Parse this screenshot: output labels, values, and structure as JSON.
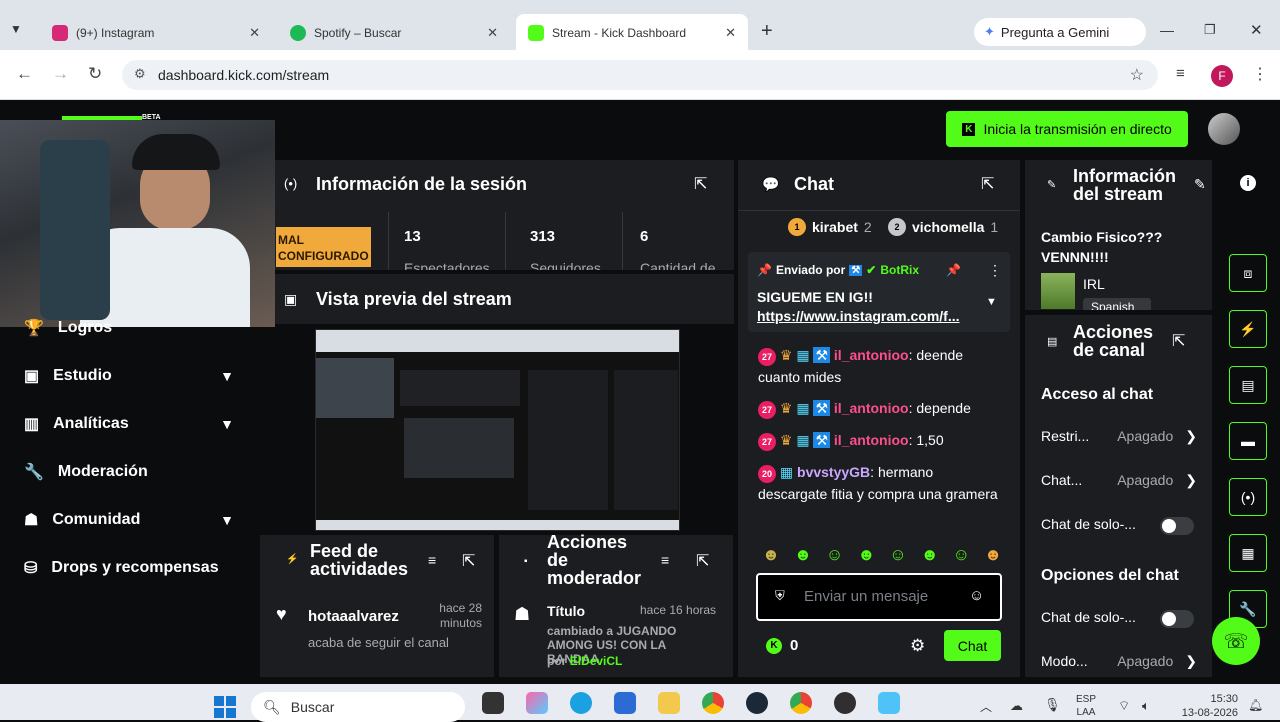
{
  "browser": {
    "tabs": [
      {
        "label": "(9+) Instagram",
        "color": "#d62976"
      },
      {
        "label": "Spotify – Buscar",
        "color": "#1db954"
      },
      {
        "label": "Stream - Kick Dashboard",
        "color": "#53fc18"
      }
    ],
    "gemini": "Pregunta a Gemini",
    "url": "dashboard.kick.com/stream",
    "profile": "F"
  },
  "header": {
    "go_live": "Inicia la transmisión en directo",
    "beta": "BETA"
  },
  "sidebar": {
    "items": [
      {
        "label": "Logros"
      },
      {
        "label": "Estudio"
      },
      {
        "label": "Analíticas"
      },
      {
        "label": "Moderación"
      },
      {
        "label": "Comunidad"
      },
      {
        "label": "Drops y recompensas"
      }
    ]
  },
  "session": {
    "title": "Información de la sesión",
    "status": "MAL CONFIGURADO",
    "stats": [
      {
        "value": "13",
        "label": "Espectadores"
      },
      {
        "value": "313",
        "label": "Seguidores"
      },
      {
        "value": "6",
        "label": "Cantidad de"
      }
    ]
  },
  "preview": {
    "title": "Vista previa del stream"
  },
  "activity": {
    "title": "Feed de actividades",
    "user": "hotaaalvarez",
    "time": "hace 28 minutos",
    "text": "acaba de seguir el canal"
  },
  "modactions": {
    "title": "Acciones de moderador",
    "item_title": "Título",
    "time": "hace 16 horas",
    "text": "cambiado a JUGANDO AMONG US! CON LA BANDAA",
    "by": "por",
    "author": "ElDeviCL"
  },
  "chat": {
    "title": "Chat",
    "top": [
      {
        "name": "kirabet",
        "count": "2",
        "rank": "1"
      },
      {
        "name": "vichomella",
        "count": "1",
        "rank": "2"
      }
    ],
    "pinned_by": "Enviado por",
    "pinned_author": "BotRix",
    "pinned_text": "SIGUEME EN IG!!",
    "pinned_link": "https://www.instagram.com/f...",
    "messages": [
      {
        "badge": "27",
        "user": "il_antonioo",
        "text": "deende cuanto mides"
      },
      {
        "badge": "27",
        "user": "il_antonioo",
        "text": "depende"
      },
      {
        "badge": "27",
        "user": "il_antonioo",
        "text": "1,50"
      },
      {
        "badge": "20",
        "user": "bvvstyyGB",
        "text": "hermano descargate fitia y compra una gramera"
      }
    ],
    "placeholder": "Enviar un mensaje",
    "points": "0",
    "send": "Chat"
  },
  "streaminfo": {
    "title": "Información del stream",
    "stream_title": "Cambio Fisico??? VENNN!!!!",
    "category": "IRL",
    "language": "Spanish"
  },
  "channel": {
    "title": "Acciones de canal",
    "access_heading": "Acceso al chat",
    "restrict_label": "Restri...",
    "restrict_value": "Apagado",
    "chat_label": "Chat...",
    "chat_value": "Apagado",
    "solo_label": "Chat de solo-...",
    "options_heading": "Opciones del chat",
    "solo2_label": "Chat de solo-...",
    "mode_label": "Modo...",
    "mode_value": "Apagado"
  },
  "taskbar": {
    "search": "Buscar",
    "lang1": "ESP",
    "lang2": "LAA",
    "time": "15:30",
    "date": "13-08-2026"
  }
}
